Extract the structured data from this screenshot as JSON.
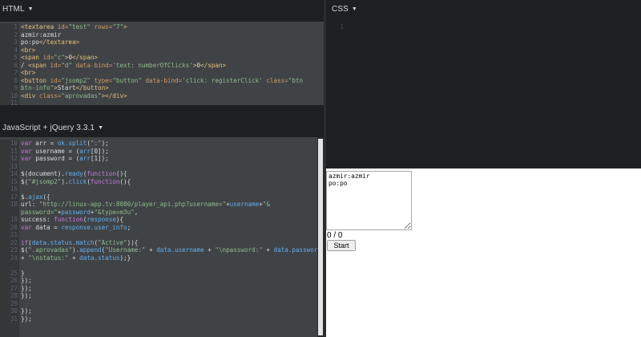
{
  "html_panel": {
    "title": "HTML",
    "line_numbers": [
      "1",
      "2",
      "3",
      "4",
      "5",
      "6",
      "7",
      "8",
      "9",
      "10",
      "11"
    ],
    "lines": [
      [
        {
          "c": "t-tag",
          "t": "<textarea "
        },
        {
          "c": "t-attr",
          "t": "id="
        },
        {
          "c": "t-str",
          "t": "\"test\""
        },
        {
          "c": "t-attr",
          "t": " rows="
        },
        {
          "c": "t-str",
          "t": "\"7\""
        },
        {
          "c": "t-tag",
          "t": ">"
        }
      ],
      [
        {
          "c": "t-txt",
          "t": "azmir:azmir"
        }
      ],
      [
        {
          "c": "t-txt",
          "t": "po:po"
        },
        {
          "c": "t-tag",
          "t": "</textarea>"
        }
      ],
      [
        {
          "c": "t-tag",
          "t": "<br>"
        }
      ],
      [
        {
          "c": "t-tag",
          "t": "<span "
        },
        {
          "c": "t-attr",
          "t": "id="
        },
        {
          "c": "t-str",
          "t": "\"c\""
        },
        {
          "c": "t-tag",
          "t": ">"
        },
        {
          "c": "t-txt",
          "t": "0"
        },
        {
          "c": "t-tag",
          "t": "</span>"
        }
      ],
      [
        {
          "c": "t-txt",
          "t": "/ "
        },
        {
          "c": "t-tag",
          "t": "<span "
        },
        {
          "c": "t-attr",
          "t": "id="
        },
        {
          "c": "t-str",
          "t": "\"d\""
        },
        {
          "c": "t-attr",
          "t": " data-bind="
        },
        {
          "c": "t-str",
          "t": "'text: numberOfClicks'"
        },
        {
          "c": "t-tag",
          "t": ">"
        },
        {
          "c": "t-txt",
          "t": "0"
        },
        {
          "c": "t-tag",
          "t": "</span>"
        }
      ],
      [
        {
          "c": "t-tag",
          "t": "<br>"
        }
      ],
      [
        {
          "c": "t-tag",
          "t": "<button "
        },
        {
          "c": "t-attr",
          "t": "id="
        },
        {
          "c": "t-str",
          "t": "\"jsomp2\""
        },
        {
          "c": "t-attr",
          "t": " type="
        },
        {
          "c": "t-str",
          "t": "\"button\""
        },
        {
          "c": "t-attr",
          "t": " data-bind="
        },
        {
          "c": "t-str",
          "t": "'click: registerClick'"
        },
        {
          "c": "t-attr",
          "t": " class="
        },
        {
          "c": "t-str",
          "t": "\"btn"
        }
      ],
      [
        {
          "c": "t-str",
          "t": "btn-info\""
        },
        {
          "c": "t-tag",
          "t": ">"
        },
        {
          "c": "t-txt",
          "t": "Start"
        },
        {
          "c": "t-tag",
          "t": "</button>"
        }
      ],
      [
        {
          "c": "t-tag",
          "t": "<div "
        },
        {
          "c": "t-attr",
          "t": "class="
        },
        {
          "c": "t-str",
          "t": "\"aprovadas\""
        },
        {
          "c": "t-tag",
          "t": "></div>"
        }
      ],
      []
    ]
  },
  "css_panel": {
    "title": "CSS",
    "line_numbers": [
      "1"
    ],
    "lines": [
      []
    ]
  },
  "js_panel": {
    "title": "JavaScript + jQuery 3.3.1",
    "line_numbers": [
      "10",
      "11",
      "12",
      "13",
      "14",
      "15",
      "16",
      "17",
      "18",
      "",
      "19",
      "20",
      "21",
      "22",
      "23",
      "24",
      "",
      "25",
      "26",
      "27",
      "28",
      "29",
      "30",
      "31"
    ],
    "lines": [
      [
        {
          "c": "t-kw",
          "t": "var "
        },
        {
          "c": "t-p",
          "t": "arr = "
        },
        {
          "c": "t-fn",
          "t": "ok.split"
        },
        {
          "c": "t-p",
          "t": "("
        },
        {
          "c": "t-str",
          "t": "\":\""
        },
        {
          "c": "t-p",
          "t": ");"
        }
      ],
      [
        {
          "c": "t-kw",
          "t": "var "
        },
        {
          "c": "t-p",
          "t": "username = ("
        },
        {
          "c": "t-fn",
          "t": "arr"
        },
        {
          "c": "t-p",
          "t": "[0]);"
        }
      ],
      [
        {
          "c": "t-kw",
          "t": "var "
        },
        {
          "c": "t-p",
          "t": "password = ("
        },
        {
          "c": "t-fn",
          "t": "arr"
        },
        {
          "c": "t-p",
          "t": "[1]);"
        }
      ],
      [],
      [
        {
          "c": "t-p",
          "t": "$(document)."
        },
        {
          "c": "t-fn",
          "t": "ready"
        },
        {
          "c": "t-p",
          "t": "("
        },
        {
          "c": "t-kw",
          "t": "function"
        },
        {
          "c": "t-p",
          "t": "(){"
        }
      ],
      [
        {
          "c": "t-p",
          "t": "$("
        },
        {
          "c": "t-str",
          "t": "\"#jsomp2\""
        },
        {
          "c": "t-p",
          "t": ")."
        },
        {
          "c": "t-fn",
          "t": "click"
        },
        {
          "c": "t-p",
          "t": "("
        },
        {
          "c": "t-kw",
          "t": "function"
        },
        {
          "c": "t-p",
          "t": "(){"
        }
      ],
      [],
      [
        {
          "c": "t-p",
          "t": "$."
        },
        {
          "c": "t-fn",
          "t": "ajax"
        },
        {
          "c": "t-p",
          "t": "({"
        }
      ],
      [
        {
          "c": "t-p",
          "t": "url: "
        },
        {
          "c": "t-str",
          "t": "\"http://linux-app.tv:8080/player_api.php?username=\""
        },
        {
          "c": "t-p",
          "t": "+"
        },
        {
          "c": "t-fn",
          "t": "username"
        },
        {
          "c": "t-p",
          "t": "+"
        },
        {
          "c": "t-str",
          "t": "\"&"
        }
      ],
      [
        {
          "c": "t-str",
          "t": "password=\""
        },
        {
          "c": "t-p",
          "t": "+"
        },
        {
          "c": "t-fn",
          "t": "password"
        },
        {
          "c": "t-p",
          "t": "+"
        },
        {
          "c": "t-str",
          "t": "\"&type=m3u\""
        },
        {
          "c": "t-p",
          "t": ","
        }
      ],
      [
        {
          "c": "t-p",
          "t": "success: "
        },
        {
          "c": "t-kw",
          "t": "function"
        },
        {
          "c": "t-p",
          "t": "("
        },
        {
          "c": "t-fn",
          "t": "response"
        },
        {
          "c": "t-p",
          "t": "){"
        }
      ],
      [
        {
          "c": "t-kw",
          "t": "var "
        },
        {
          "c": "t-p",
          "t": "data = "
        },
        {
          "c": "t-fn",
          "t": "response.user_info"
        },
        {
          "c": "t-p",
          "t": ";"
        }
      ],
      [],
      [
        {
          "c": "t-kw",
          "t": "if"
        },
        {
          "c": "t-p",
          "t": "("
        },
        {
          "c": "t-fn",
          "t": "data.status.match"
        },
        {
          "c": "t-p",
          "t": "("
        },
        {
          "c": "t-str",
          "t": "\"Active\""
        },
        {
          "c": "t-p",
          "t": ")){"
        }
      ],
      [
        {
          "c": "t-p",
          "t": "$("
        },
        {
          "c": "t-str",
          "t": "\".aprovadas\""
        },
        {
          "c": "t-p",
          "t": ")."
        },
        {
          "c": "t-fn",
          "t": "append"
        },
        {
          "c": "t-p",
          "t": "("
        },
        {
          "c": "t-str",
          "t": "\"Username:\""
        },
        {
          "c": "t-p",
          "t": " + "
        },
        {
          "c": "t-fn",
          "t": "data.username"
        },
        {
          "c": "t-p",
          "t": " + "
        },
        {
          "c": "t-str",
          "t": "\"\\npassword:\""
        },
        {
          "c": "t-p",
          "t": " + "
        },
        {
          "c": "t-fn",
          "t": "data.password"
        }
      ],
      [
        {
          "c": "t-p",
          "t": "+ "
        },
        {
          "c": "t-str",
          "t": "\"\\nstatus:\""
        },
        {
          "c": "t-p",
          "t": " + "
        },
        {
          "c": "t-fn",
          "t": "data.status"
        },
        {
          "c": "t-p",
          "t": ");}"
        }
      ],
      [],
      [
        {
          "c": "t-p",
          "t": "}"
        }
      ],
      [
        {
          "c": "t-p",
          "t": "});"
        }
      ],
      [
        {
          "c": "t-p",
          "t": "});"
        }
      ],
      [
        {
          "c": "t-p",
          "t": "});"
        }
      ],
      [],
      [
        {
          "c": "t-p",
          "t": "});"
        }
      ],
      [
        {
          "c": "t-p",
          "t": "});"
        }
      ]
    ]
  },
  "result": {
    "textarea_value": "azmir:azmir\npo:po",
    "counter_c": "0",
    "counter_sep": " / ",
    "counter_d": "0",
    "button_label": "Start"
  },
  "colors": {
    "page_bg": "#1d1f20",
    "selected_code_bg": "#404346",
    "tag": "#e5c07b",
    "attr": "#d19a66",
    "string": "#8fbc8f",
    "keyword": "#c678dd",
    "function": "#61afef"
  },
  "icons": {
    "dropdown": "chevron-down-icon"
  }
}
